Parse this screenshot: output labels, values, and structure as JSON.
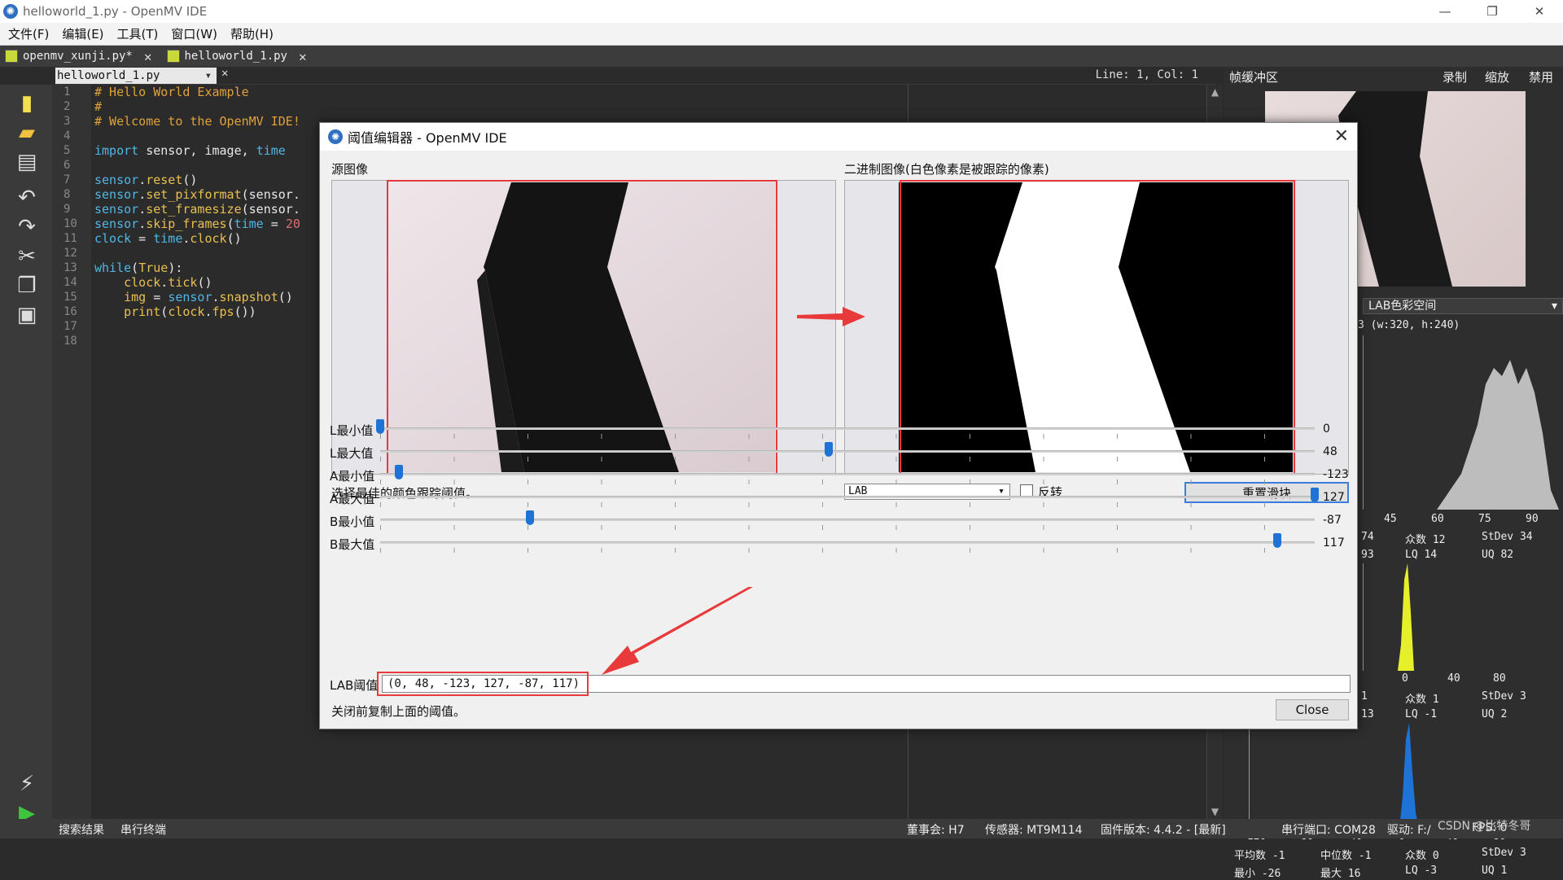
{
  "window": {
    "title": "helloworld_1.py - OpenMV IDE",
    "minimize": "—",
    "maximize": "❐",
    "close": "✕"
  },
  "menu": [
    "文件(F)",
    "编辑(E)",
    "工具(T)",
    "窗口(W)",
    "帮助(H)"
  ],
  "tabs": [
    {
      "label": "openmv_xunji.py*",
      "close": "✕"
    },
    {
      "label": "helloworld_1.py",
      "close": "✕"
    }
  ],
  "editor": {
    "file_select": "helloworld_1.py",
    "close": "✕",
    "position": "Line: 1, Col: 1"
  },
  "code_lines": [
    [
      [
        "c-com",
        "# Hello World Example"
      ]
    ],
    [
      [
        "c-com",
        "#"
      ]
    ],
    [
      [
        "c-com",
        "# Welcome to the OpenMV IDE!"
      ]
    ],
    [],
    [
      [
        "c-kw",
        "import"
      ],
      [
        "c-id",
        " sensor, image, "
      ],
      [
        "c-kw",
        "time"
      ]
    ],
    [],
    [
      [
        "c-kw",
        "sensor"
      ],
      [
        "c-id",
        "."
      ],
      [
        "c-fn",
        "reset"
      ],
      [
        "c-id",
        "()"
      ]
    ],
    [
      [
        "c-kw",
        "sensor"
      ],
      [
        "c-id",
        "."
      ],
      [
        "c-fn",
        "set_pixformat"
      ],
      [
        "c-id",
        "(sensor."
      ]
    ],
    [
      [
        "c-kw",
        "sensor"
      ],
      [
        "c-id",
        "."
      ],
      [
        "c-fn",
        "set_framesize"
      ],
      [
        "c-id",
        "(sensor."
      ]
    ],
    [
      [
        "c-kw",
        "sensor"
      ],
      [
        "c-id",
        "."
      ],
      [
        "c-fn",
        "skip_frames"
      ],
      [
        "c-id",
        "("
      ],
      [
        "c-kw",
        "time"
      ],
      [
        "c-id",
        " = "
      ],
      [
        "c-num",
        "20"
      ]
    ],
    [
      [
        "c-kw",
        "clock"
      ],
      [
        "c-id",
        " = "
      ],
      [
        "c-kw",
        "time"
      ],
      [
        "c-id",
        "."
      ],
      [
        "c-fn",
        "clock"
      ],
      [
        "c-id",
        "()"
      ]
    ],
    [],
    [
      [
        "c-kw",
        "while"
      ],
      [
        "c-id",
        "("
      ],
      [
        "c-fn",
        "True"
      ],
      [
        "c-id",
        "):"
      ]
    ],
    [
      [
        "c-id",
        "    "
      ],
      [
        "c-fn",
        "clock"
      ],
      [
        "c-id",
        "."
      ],
      [
        "c-fn",
        "tick"
      ],
      [
        "c-id",
        "()"
      ]
    ],
    [
      [
        "c-id",
        "    "
      ],
      [
        "c-fn",
        "img"
      ],
      [
        "c-id",
        " = "
      ],
      [
        "c-kw",
        "sensor"
      ],
      [
        "c-id",
        "."
      ],
      [
        "c-fn",
        "snapshot"
      ],
      [
        "c-id",
        "()"
      ]
    ],
    [
      [
        "c-id",
        "    "
      ],
      [
        "c-fn",
        "print"
      ],
      [
        "c-id",
        "("
      ],
      [
        "c-fn",
        "clock"
      ],
      [
        "c-id",
        "."
      ],
      [
        "c-fn",
        "fps"
      ],
      [
        "c-id",
        "())"
      ]
    ],
    [],
    []
  ],
  "line_numbers": [
    "1",
    "2",
    "3",
    "4",
    "5",
    "6",
    "7",
    "8",
    "9",
    "10",
    "11",
    "12",
    "13",
    "14",
    "15",
    "16",
    "17",
    "18"
  ],
  "right_panel": {
    "header": "帧缓冲区",
    "record": "录制",
    "zoom": "缩放",
    "disable": "禁用",
    "colorspace": "LAB色彩空间",
    "res": "3  (w:320, h:240)",
    "h1_axis": [
      "45",
      "60",
      "75",
      "90"
    ],
    "h1_stats1": [
      "74",
      "众数 12",
      "StDev 34"
    ],
    "h1_stats2": [
      "93",
      "LQ   14",
      "UQ   82"
    ],
    "h2_axis": [
      "0",
      "40",
      "80"
    ],
    "h2_stats1": [
      "1",
      "众数 1",
      "StDev 3"
    ],
    "h2_stats2": [
      "13",
      "LQ   -1",
      "UQ   2"
    ],
    "h3_axis": [
      "-120",
      "-80",
      "-40",
      "0",
      "40",
      "80"
    ],
    "h3_stats1": [
      "平均数 -1",
      "中位数 -1",
      "众数 0",
      "StDev 3"
    ],
    "h3_stats2": [
      "最小  -26",
      "最大  16",
      "LQ   -3",
      "UQ   1"
    ]
  },
  "dialog": {
    "title": "阈值编辑器 - OpenMV IDE",
    "close": "✕",
    "source_label": "源图像",
    "binary_label": "二进制图像(白色像素是被跟踪的像素)",
    "select_text": "选择最佳的颜色跟踪阈值。",
    "colorspace": "LAB",
    "invert": "反转",
    "reset": "重置滑块",
    "sliders": [
      {
        "label": "L最小值",
        "value": "0",
        "pos": 0.0
      },
      {
        "label": "L最大值",
        "value": "48",
        "pos": 0.48
      },
      {
        "label": "A最小值",
        "value": "-123",
        "pos": 0.02
      },
      {
        "label": "A最大值",
        "value": "127",
        "pos": 1.0
      },
      {
        "label": "B最小值",
        "value": "-87",
        "pos": 0.16
      },
      {
        "label": "B最大值",
        "value": "117",
        "pos": 0.96
      }
    ],
    "threshold_label": "LAB阈值",
    "threshold_value": "(0,  48,  -123,  127,  -87,  117)",
    "footer_text": "关闭前复制上面的阈值。",
    "close_btn": "Close"
  },
  "status": {
    "search": "搜索结果",
    "serial": "串行终端",
    "board": "董事会: H7",
    "sensor": "传感器: MT9M114",
    "firmware": "固件版本: 4.4.2 - [最新]",
    "port": "串行端口: COM28",
    "drive": "驱动: F:/",
    "fps": "FPS: 0",
    "watermark": "CSDN @比特冬哥"
  },
  "colors": {
    "accent": "#1f73d6",
    "red": "#e83a3a"
  }
}
